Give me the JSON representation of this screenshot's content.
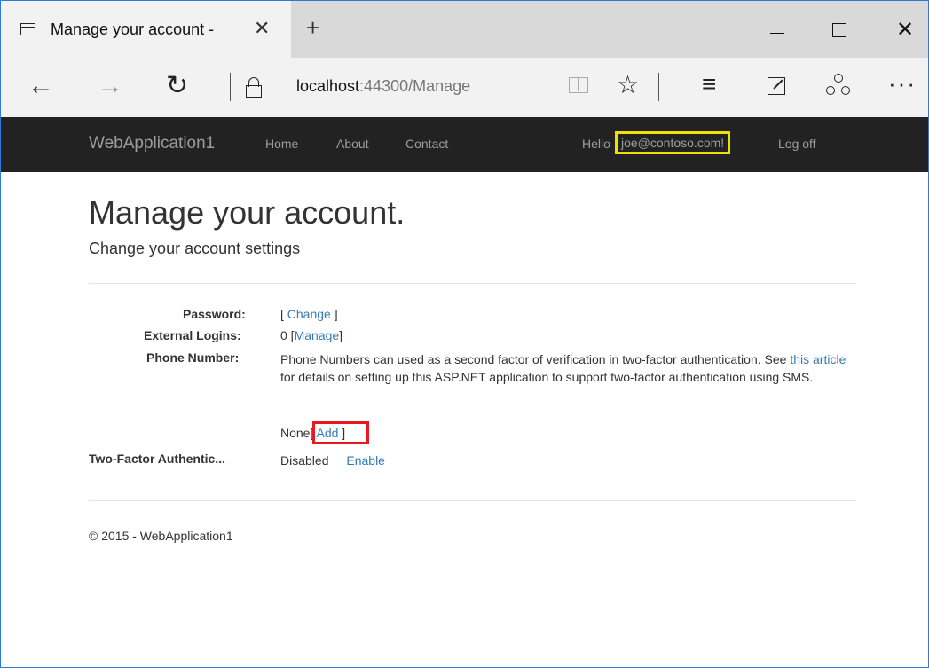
{
  "browser": {
    "tab_title": "Manage your account - ",
    "tab_close": "✕",
    "new_tab": "+",
    "close_window": "✕",
    "url_host": "localhost",
    "url_rest": ":44300/Manage",
    "icons": {
      "back": "arrow-left-icon",
      "forward": "arrow-right-icon",
      "refresh": "refresh-icon",
      "lock": "lock-icon",
      "reading_view": "book-icon",
      "favorite": "star-icon",
      "hub": "hub-icon",
      "web_note": "pen-note-icon",
      "share": "share-icon",
      "more": "more-icon"
    }
  },
  "site": {
    "brand": "WebApplication1",
    "nav": {
      "home": "Home",
      "about": "About",
      "contact": "Contact"
    },
    "hello": "Hello",
    "email": "joe@contoso.com!",
    "logoff": "Log off"
  },
  "page": {
    "title": "Manage your account.",
    "subtitle": "Change your account settings",
    "password_label": "Password:",
    "password_open": "[ ",
    "password_link": "Change",
    "password_close": " ]",
    "external_label": "External Logins:",
    "external_count": "0 [",
    "external_link": "Manage",
    "external_close": "]",
    "phone_label": "Phone Number:",
    "phone_text_1": "Phone Numbers can used as a second factor of verification in two-factor authentication. See ",
    "phone_link": "this article",
    "phone_text_2": " for details on setting up this ASP.NET application to support two-factor authentication using SMS.",
    "phone_value": "None",
    "phone_add_open": "[ ",
    "phone_add_link": "Add",
    "phone_add_close": " ]",
    "tfa_label": "Two-Factor Authentic...",
    "tfa_status": "Disabled",
    "tfa_link": "Enable"
  },
  "footer": {
    "text": "© 2015 - WebApplication1"
  },
  "colors": {
    "navbar_bg": "#222222",
    "link": "#337ab7",
    "highlight_yellow": "#f0e000",
    "highlight_red": "#e8191f"
  }
}
